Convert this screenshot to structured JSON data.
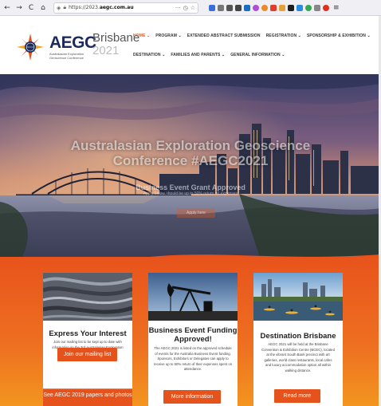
{
  "browser": {
    "url_prefix": "https://2023.",
    "url_domain": "aegc.com.au",
    "more_label": "···",
    "nav_back": "←",
    "nav_forward": "→",
    "nav_reload": "C",
    "nav_home": "⌂"
  },
  "logo": {
    "name": "AEGC",
    "subtitle_line1": "Australasian Exploration",
    "subtitle_line2": "Geoscience Conference",
    "city": "Brisbane",
    "year": "2021"
  },
  "nav": {
    "row1": [
      "HOME ⌄",
      "PROGRAM ⌄",
      "EXTENDED ABSTRACT SUBMISSION",
      "REGISTRATION ⌄",
      "SPONSORSHIP & EXHIBITION ⌄"
    ],
    "row2": [
      "DESTINATION ⌄",
      "FAMILIES AND PARENTS ⌄",
      "GENERAL INFORMATION ⌄"
    ]
  },
  "hero": {
    "title_line1": "Australasian Exploration Geoscience",
    "title_line2": "Conference #AEGC2021",
    "subtitle": "Business Event Grant Approved",
    "subsubtitle": "Apply below should be up to 50% return on expenses",
    "button": "Apply here"
  },
  "cards": [
    {
      "title": "Express Your Interest",
      "text": "Join our mailing list to be kept up to date with information on the 3rd Australasian Exploration Geoscience Conference.",
      "button": "Join our mailing list"
    },
    {
      "title": "Business Event Funding Approved!",
      "text": "The AEGC 2021 is listed on the approved schedule of events for the Australia Business Event funding. Sponsors, Exhibitors or Delegates can apply to receive up to 50% return of their expenses spent on attendance.",
      "button": "More information"
    },
    {
      "title": "Destination Brisbane",
      "text": "AEGC 2021 will be held at the Brisbane Convention & Exhibition Centre (BCEC), located at the vibrant South Bank precinct with art galleries, world class restaurants, local cafes and luxury accommodation option all within walking distance.",
      "button": "Read more"
    }
  ],
  "bottom_button": "See AEGC 2019 papers and photos",
  "colors": {
    "accent": "#e6521b",
    "navy": "#1d2a5c"
  }
}
